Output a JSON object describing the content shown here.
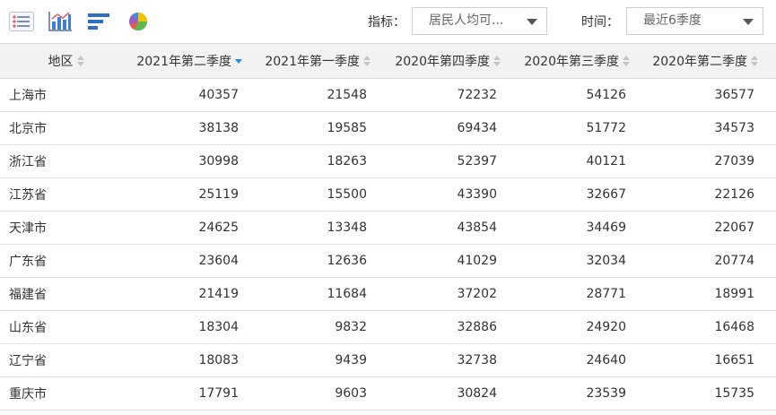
{
  "toolbar": {
    "views": [
      {
        "icon": "table-view-icon"
      },
      {
        "icon": "bar-chart-icon"
      },
      {
        "icon": "horizontal-bar-chart-icon"
      },
      {
        "icon": "pie-chart-icon"
      }
    ],
    "indicator_label": "指标：",
    "indicator_value": "居民人均可...",
    "time_label": "时间：",
    "time_value": "最近6季度"
  },
  "table": {
    "columns": [
      "地区",
      "2021年第二季度",
      "2021年第一季度",
      "2020年第四季度",
      "2020年第三季度",
      "2020年第二季度"
    ],
    "sorted_column": "2021年第二季度",
    "sort_direction": "desc",
    "rows": [
      {
        "region": "上海市",
        "values": [
          "40357",
          "21548",
          "72232",
          "54126",
          "36577"
        ]
      },
      {
        "region": "北京市",
        "values": [
          "38138",
          "19585",
          "69434",
          "51772",
          "34573"
        ]
      },
      {
        "region": "浙江省",
        "values": [
          "30998",
          "18263",
          "52397",
          "40121",
          "27039"
        ]
      },
      {
        "region": "江苏省",
        "values": [
          "25119",
          "15500",
          "43390",
          "32667",
          "22126"
        ]
      },
      {
        "region": "天津市",
        "values": [
          "24625",
          "13348",
          "43854",
          "34469",
          "22067"
        ]
      },
      {
        "region": "广东省",
        "values": [
          "23604",
          "12636",
          "41029",
          "32034",
          "20774"
        ]
      },
      {
        "region": "福建省",
        "values": [
          "21419",
          "11684",
          "37202",
          "28771",
          "18991"
        ]
      },
      {
        "region": "山东省",
        "values": [
          "18304",
          "9832",
          "32886",
          "24920",
          "16468"
        ]
      },
      {
        "region": "辽宁省",
        "values": [
          "18083",
          "9439",
          "32738",
          "24640",
          "16651"
        ]
      },
      {
        "region": "重庆市",
        "values": [
          "17791",
          "9603",
          "30824",
          "23539",
          "15735"
        ]
      }
    ]
  },
  "colors": {
    "header_bg": "#f2f2f2",
    "sort_active": "#2b8ad8",
    "sort_inactive": "#c4c4c4"
  }
}
